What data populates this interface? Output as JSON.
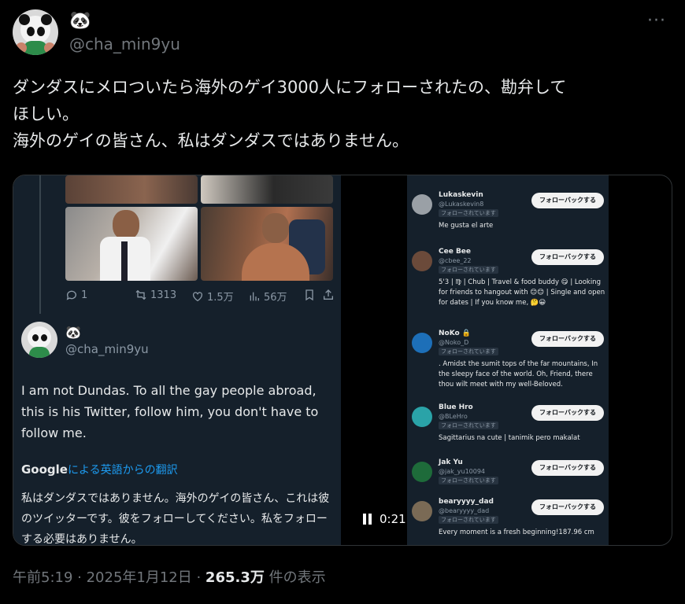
{
  "author": {
    "display_name": "🐼",
    "handle": "@cha_min9yu"
  },
  "tweet": {
    "line1": "ダンダスにメロついたら海外のゲイ3000人にフォローされたの、勘弁して",
    "line2": "ほしい。",
    "line3": "海外のゲイの皆さん、私はダンダスではありません。"
  },
  "video": {
    "quoted_actions": {
      "replies": "1",
      "retweets": "1313",
      "likes": "1.5万",
      "views": "56万"
    },
    "quoted_author": {
      "display_name": "🐼",
      "handle": "@cha_min9yu"
    },
    "quoted_text": "I am not Dundas. To all the gay people abroad, this is his Twitter, follow him, you don't have to follow me.",
    "google_logo": "Google",
    "translation_label": "による英語からの翻訳",
    "translated_text": "私はダンダスではありません。海外のゲイの皆さん、これは彼のツイッターです。彼をフォローしてください。私をフォローする必要はありません。",
    "time": "0:21",
    "followers": [
      {
        "name": "Lukaskevin",
        "handle": "@Lukaskevin8",
        "badge": "フォローされています",
        "bio": "Me gusta el arte",
        "button": "フォローバックする",
        "avatar_color": "#9aa0a6"
      },
      {
        "name": "Cee Bee",
        "handle": "@cbee_22",
        "badge": "フォローされています",
        "bio": "5'3 | ♍ | Chub | Travel & food buddy 😋 | Looking for friends to hangout with 😊😊 | Single and open for dates | If you know me, 🤔😀",
        "button": "フォローバックする",
        "avatar_color": "#6b4a3a"
      },
      {
        "name": "NoKo 🔒",
        "handle": "@Noko_D",
        "badge": "フォローされています",
        "bio": ". Amidst the sumit tops of the far mountains, In the sleepy face of the world. Oh, Friend, there thou wilt meet with my well-Beloved.",
        "button": "フォローバックする",
        "avatar_color": "#1d6fb8"
      },
      {
        "name": "Blue Hro",
        "handle": "@BLeHro",
        "badge": "フォローされています",
        "bio": "Sagittarius na cute | tanimik pero makalat",
        "button": "フォローバックする",
        "avatar_color": "#2aa3a8"
      },
      {
        "name": "Jak Yu",
        "handle": "@jak_yu10094",
        "badge": "フォローされています",
        "bio": "",
        "button": "フォローバックする",
        "avatar_color": "#1e6b3a"
      },
      {
        "name": "bearyyyy_dad",
        "handle": "@bearyyyy_dad",
        "badge": "フォローされています",
        "bio": "Every moment is a fresh beginning!187.96 cm",
        "button": "フォローバックする",
        "avatar_color": "#7a6a55"
      }
    ]
  },
  "meta": {
    "time": "午前5:19 · 2025年1月12日 · ",
    "views": "265.3万",
    "views_suffix": " 件の表示"
  }
}
